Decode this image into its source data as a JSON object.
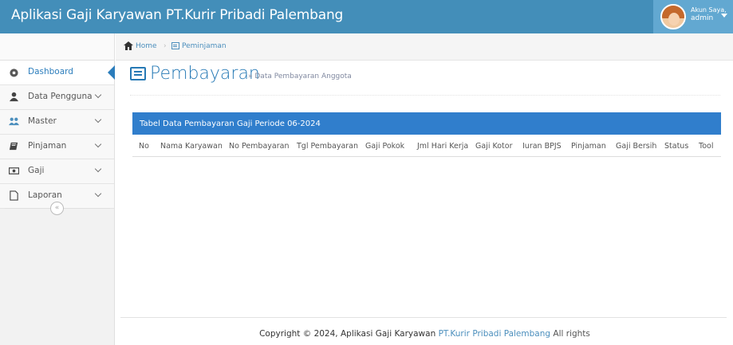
{
  "header": {
    "app_title": "Aplikasi Gaji Karyawan PT.Kurir Pribadi Palembang",
    "user_greeting": "Akun Saya,",
    "username": "admin"
  },
  "breadcrumb": {
    "home": "Home",
    "separator": "›",
    "current": "Peminjaman"
  },
  "sidebar": {
    "items": [
      {
        "label": "Dashboard",
        "icon": "dashboard-icon"
      },
      {
        "label": "Data Pengguna",
        "icon": "user-icon"
      },
      {
        "label": "Master",
        "icon": "users-icon"
      },
      {
        "label": "Pinjaman",
        "icon": "book-icon"
      },
      {
        "label": "Gaji",
        "icon": "money-icon"
      },
      {
        "label": "Laporan",
        "icon": "file-icon"
      }
    ],
    "collapse": "«"
  },
  "page": {
    "title": "Pembayaran",
    "subtitle": "» Data Pembayaran Anggota"
  },
  "table": {
    "title": "Tabel Data Pembayaran Gaji Periode 06-2024",
    "columns": [
      "No",
      "Nama Karyawan",
      "No Pembayaran",
      "Tgl Pembayaran",
      "Gaji Pokok",
      "Jml Hari Kerja",
      "Gaji Kotor",
      "Iuran BPJS",
      "Pinjaman",
      "Gaji Bersih",
      "Status",
      "Tool"
    ]
  },
  "footer": {
    "prefix": "Copyright © 2024, Aplikasi Gaji Karyawan",
    "brand": "PT.Kurir Pribadi Palembang",
    "suffix": "All rights"
  },
  "colors": {
    "topbar": "#438eb9",
    "accent": "#2679b5",
    "table_header": "#307ecc"
  }
}
